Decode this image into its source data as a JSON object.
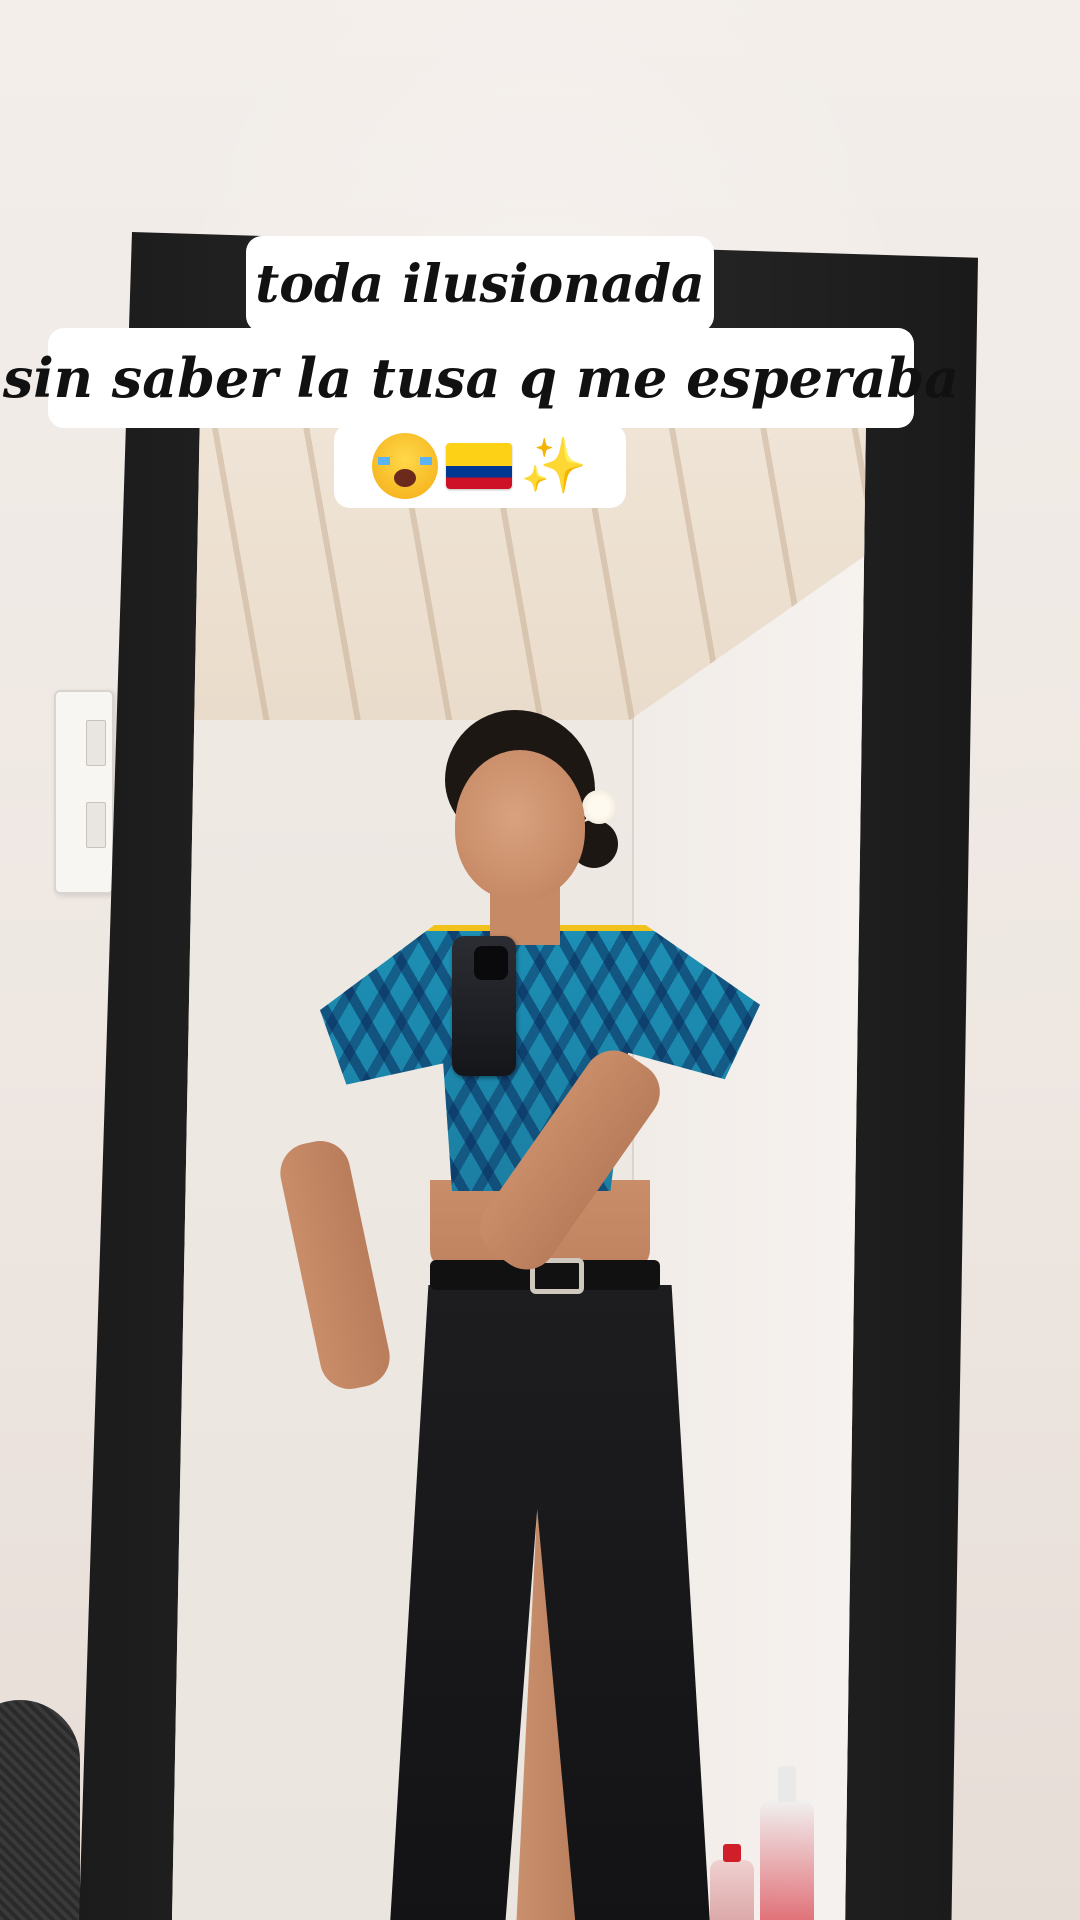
{
  "caption": {
    "line1": "toda ilusionada",
    "line2": "sin saber la tusa q me esperaba",
    "emojis": {
      "sob": "loudly-crying-face-icon",
      "flag": "colombia-flag-icon",
      "sparkles_text": "✨"
    }
  },
  "colors": {
    "caption_background": "#ffffff",
    "caption_text": "#111111",
    "jersey": "#1b7fa3",
    "jersey_trim": "#f1c21b",
    "mirror_frame": "#1b1b1b"
  }
}
